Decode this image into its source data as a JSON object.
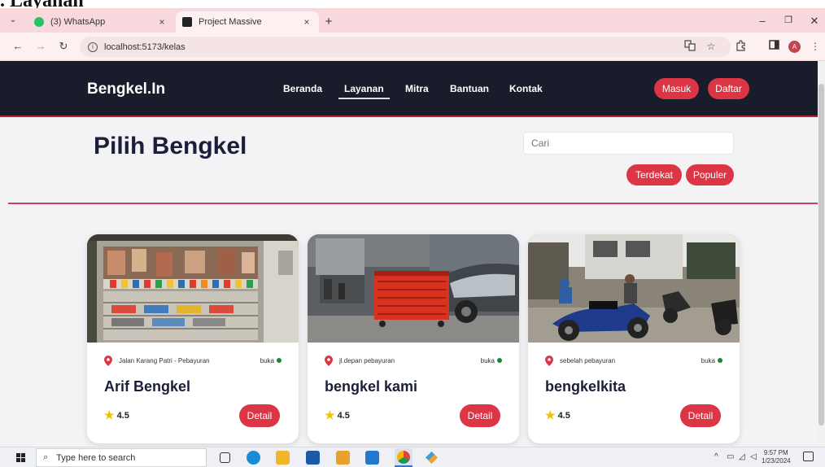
{
  "doc": {
    "heading": ". Layanan"
  },
  "browser": {
    "tabs": [
      {
        "label": "(3) WhatsApp"
      },
      {
        "label": "Project Massive"
      }
    ],
    "tab_close": "×",
    "new_tab": "+",
    "url": "localhost:5173/kelas",
    "profile_initial": "A",
    "window_controls": {
      "minimize": "–",
      "restore": "❐",
      "close": "✕"
    }
  },
  "site": {
    "brand": "Bengkel.In",
    "menu": [
      "Beranda",
      "Layanan",
      "Mitra",
      "Bantuan",
      "Kontak"
    ],
    "active_menu": "Layanan",
    "login_label": "Masuk",
    "register_label": "Daftar"
  },
  "page": {
    "title": "Pilih Bengkel",
    "search_placeholder": "Cari",
    "filters": [
      "Terdekat",
      "Populer"
    ]
  },
  "cards": [
    {
      "name": "Arif Bengkel",
      "location": "Jalan Karang Patri - Pebayuran",
      "status": "buka",
      "rating": "4.5",
      "button": "Detail"
    },
    {
      "name": "bengkel kami",
      "location": "jl.depan pebayuran",
      "status": "buka",
      "rating": "4.5",
      "button": "Detail"
    },
    {
      "name": "bengkelkita",
      "location": "sebelah pebayuran",
      "status": "buka",
      "rating": "4.5",
      "button": "Detail"
    }
  ],
  "taskbar": {
    "search_placeholder": "Type here to search",
    "time": "9:57 PM",
    "date": "1/23/2024"
  },
  "colors": {
    "accent_red": "#dc3545",
    "nav_dark": "#191c2b",
    "open_green": "#1a8a2c"
  }
}
